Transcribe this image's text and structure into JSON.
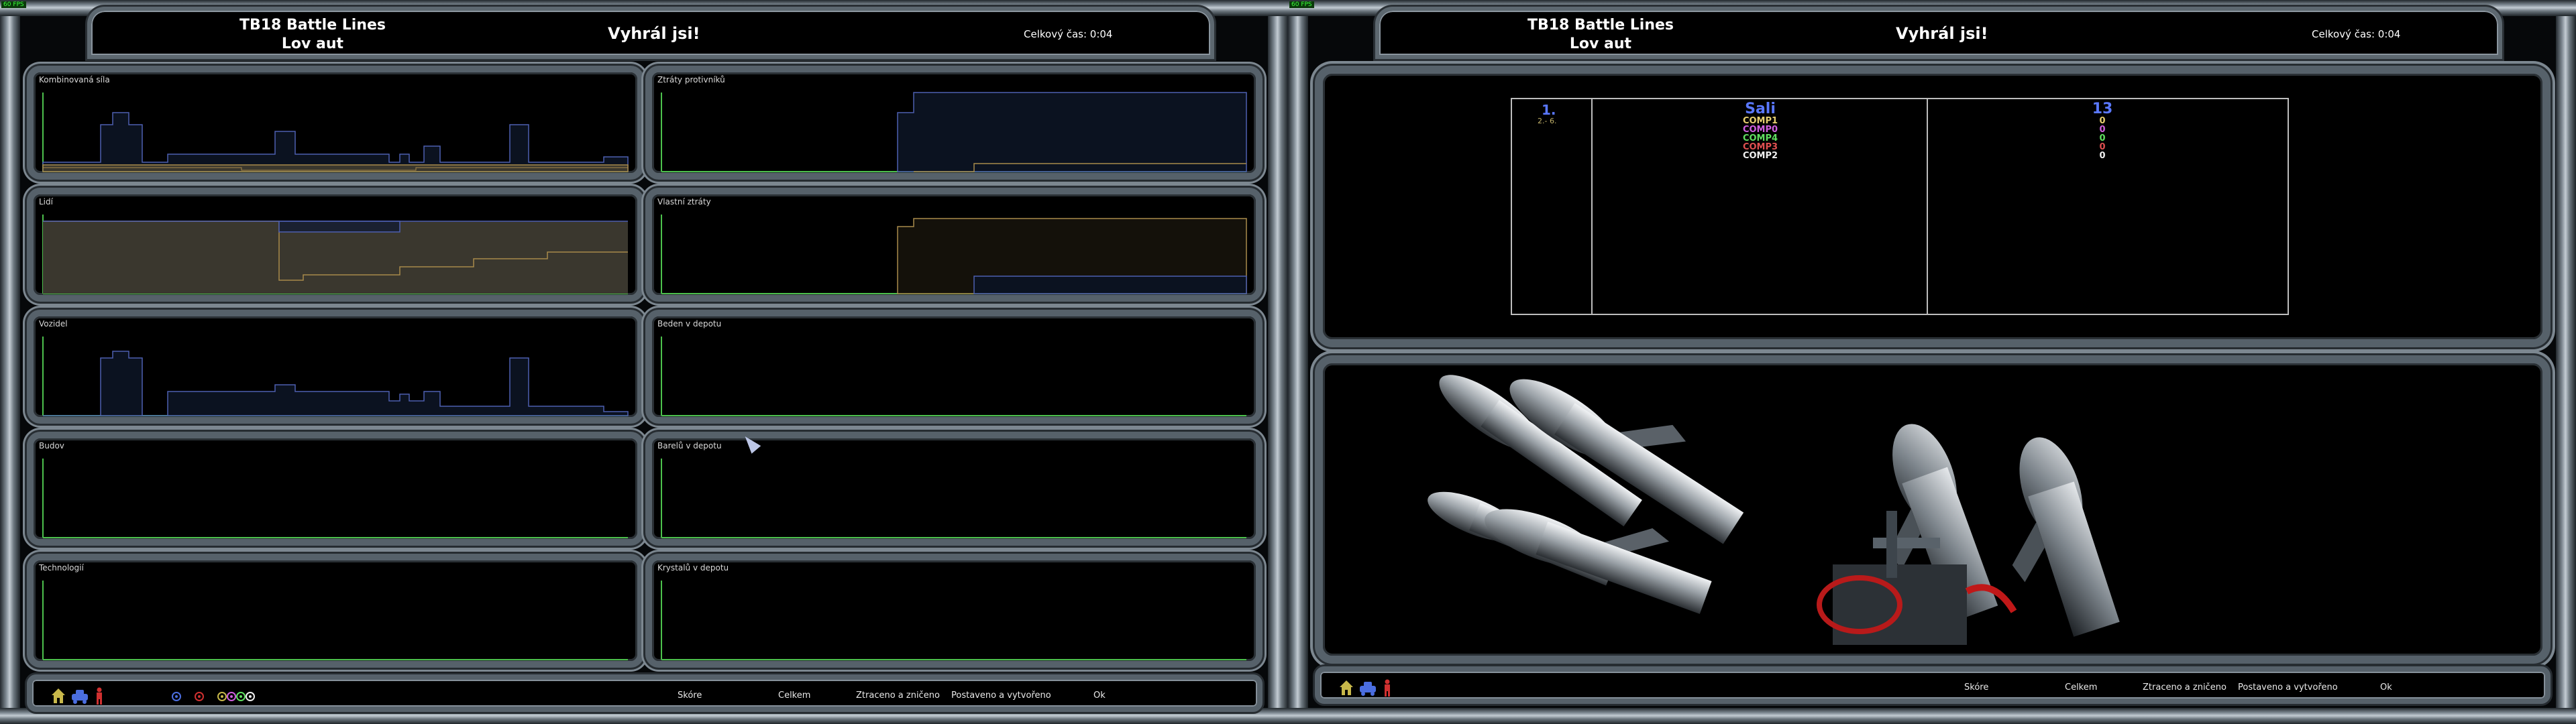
{
  "header": {
    "mission_line1": "TB18 Battle Lines",
    "mission_line2": "Lov aut",
    "result": "Vyhrál jsi!",
    "total_time": "Celkový čas: 0:04",
    "fps_badge": "60 FPS"
  },
  "graphs": {
    "combined": "Kombinovaná síla",
    "people": "Lidí",
    "vehicles": "Vozidel",
    "buildings": "Budov",
    "tech": "Technologií",
    "enemy_losses": "Ztráty protivníků",
    "own_losses": "Vlastní ztráty",
    "crates": "Beden v depotu",
    "barrels": "Barelů v depotu",
    "crystals": "Krystalů v depotu"
  },
  "footer": {
    "buttons": [
      "Skóre",
      "Celkem",
      "Ztraceno a zničeno",
      "Postaveno a vytvořeno",
      "Ok"
    ],
    "icons": [
      "house-icon",
      "vehicle-icon",
      "person-icon"
    ]
  },
  "scores": {
    "first_rank": "1.",
    "rest_rank": "2.- 6.",
    "players": [
      {
        "name": "Sali",
        "score": "13",
        "color": "#5a78ff"
      },
      {
        "name": "COMP1",
        "score": "0",
        "color": "#e8d070"
      },
      {
        "name": "COMP0",
        "score": "0",
        "color": "#d060e0"
      },
      {
        "name": "COMP4",
        "score": "0",
        "color": "#60e060"
      },
      {
        "name": "COMP3",
        "score": "0",
        "color": "#e05050"
      },
      {
        "name": "COMP2",
        "score": "0",
        "color": "#f0f0f0"
      }
    ]
  },
  "colors": {
    "player_blue": "#4d5fb0",
    "player_gold": "#a88a4a",
    "axis_green": "#4cc04c"
  }
}
